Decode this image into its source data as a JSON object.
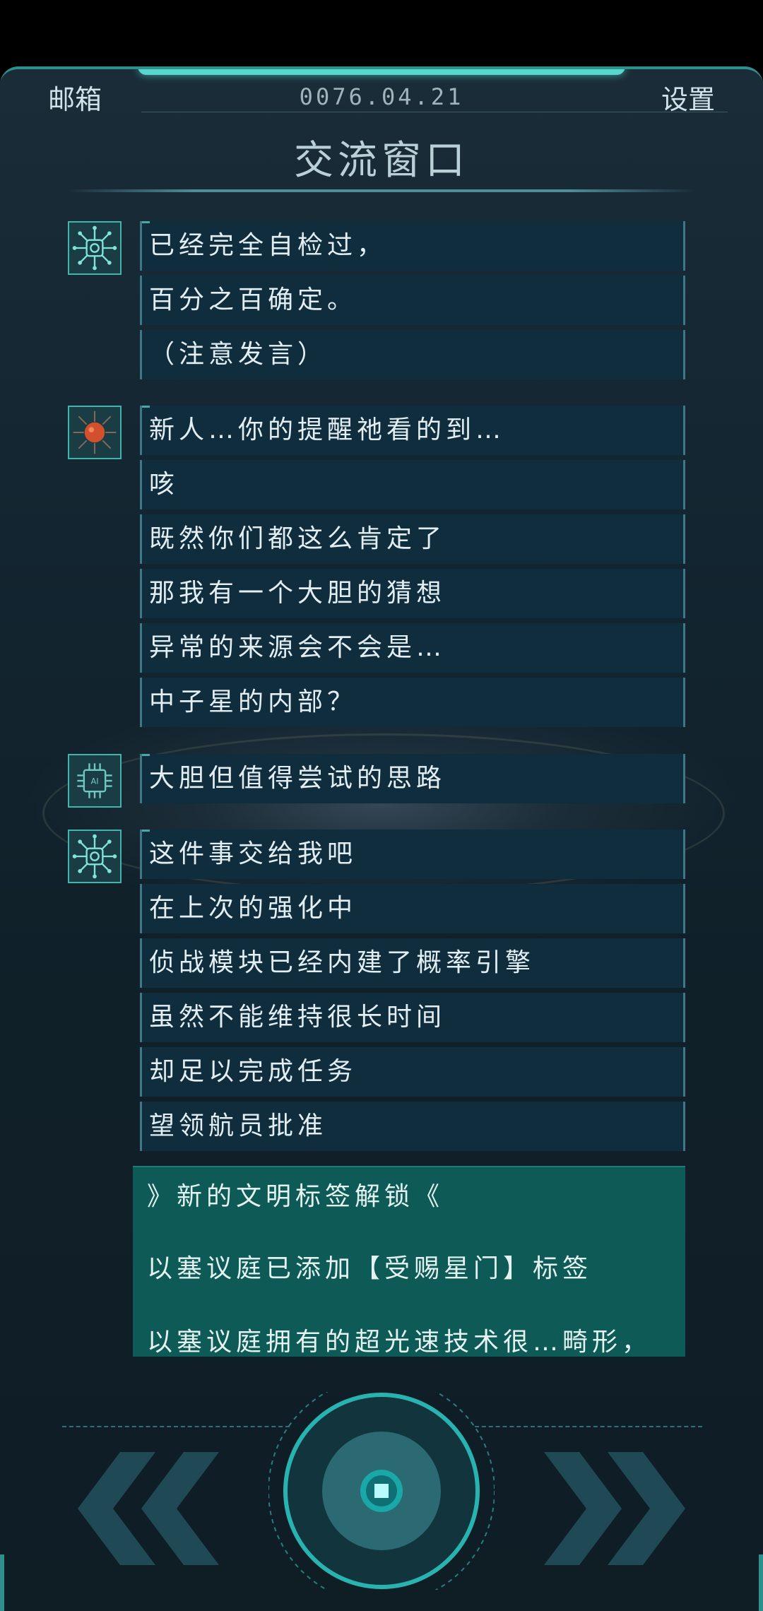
{
  "header": {
    "mailbox_label": "邮箱",
    "date": "0076.04.21",
    "settings_label": "设置",
    "title": "交流窗口"
  },
  "conversation": [
    {
      "avatar_icon": "circuit-chip-icon",
      "messages": [
        "已经完全自检过，",
        "百分之百确定。",
        "（注意发言）"
      ]
    },
    {
      "avatar_icon": "red-orb-circuit-icon",
      "messages": [
        "新人…你的提醒祂看的到…",
        "咳",
        "既然你们都这么肯定了",
        "那我有一个大胆的猜想",
        "异常的来源会不会是…",
        "中子星的内部？"
      ]
    },
    {
      "avatar_icon": "ai-chip-icon",
      "messages": [
        "大胆但值得尝试的思路"
      ]
    },
    {
      "avatar_icon": "circuit-chip-icon",
      "messages": [
        "这件事交给我吧",
        "在上次的强化中",
        "侦战模块已经内建了概率引擎",
        "虽然不能维持很长时间",
        "却足以完成任务",
        "望领航员批准"
      ]
    }
  ],
  "unlock_notice": {
    "heading": "》新的文明标签解锁《",
    "line1": "以塞议庭已添加【受赐星门】标签",
    "line2": "以塞议庭拥有的超光速技术很…畸形，"
  },
  "controls": {
    "back_icon": "double-chevron-left-icon",
    "center_icon": "record-button-icon",
    "forward_icon": "double-chevron-right-icon"
  },
  "colors": {
    "accent": "#3fb5ad",
    "bubble": "#0f2d3d",
    "unlock_bg": "#0d5a57",
    "text": "#e3eef2"
  }
}
